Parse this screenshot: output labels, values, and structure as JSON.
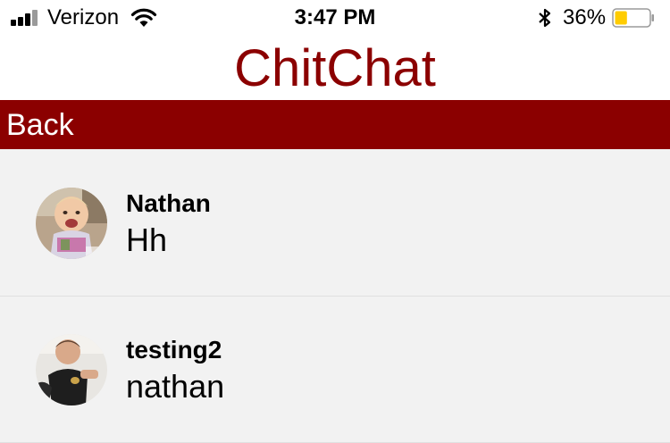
{
  "status_bar": {
    "carrier": "Verizon",
    "time": "3:47 PM",
    "battery_percent": "36%",
    "battery_level": 0.36,
    "battery_color": "#ffcc00",
    "icons": [
      "signal-icon",
      "wifi-icon",
      "bluetooth-icon",
      "battery-icon"
    ]
  },
  "header": {
    "title": "ChitChat",
    "title_color": "#8b0000"
  },
  "nav": {
    "back_label": "Back",
    "bar_color": "#8b0000"
  },
  "conversations": [
    {
      "name": "Nathan",
      "last_message": "Hh",
      "avatar": "baby-photo-avatar"
    },
    {
      "name": "testing2",
      "last_message": "nathan",
      "avatar": "toddler-photo-avatar"
    }
  ]
}
